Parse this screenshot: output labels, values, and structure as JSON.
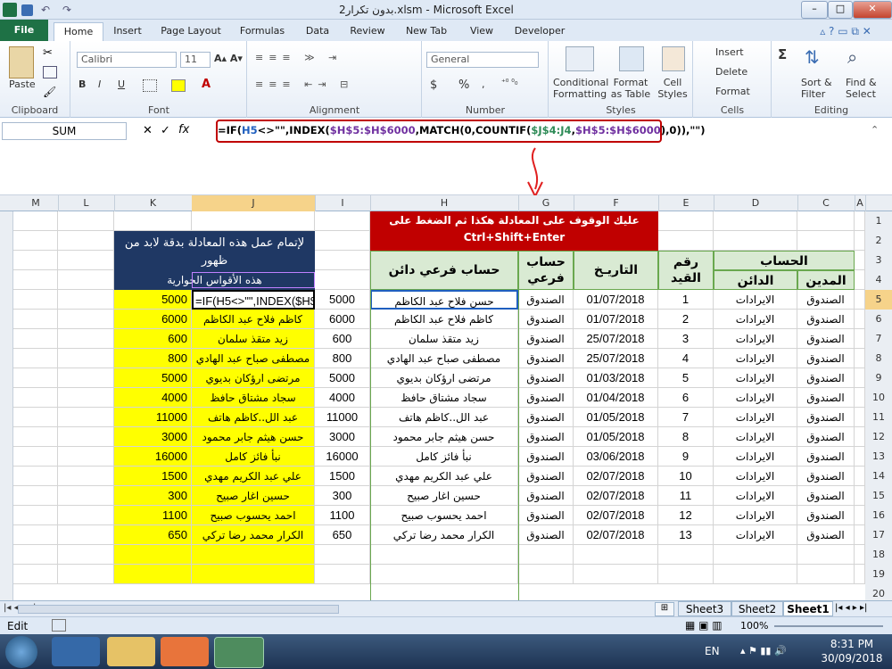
{
  "window": {
    "title": "بدون تكرار2.xlsm - Microsoft Excel"
  },
  "tabs": [
    {
      "label": "File"
    },
    {
      "label": "Home"
    },
    {
      "label": "Insert"
    },
    {
      "label": "Page Layout"
    },
    {
      "label": "Formulas"
    },
    {
      "label": "Data"
    },
    {
      "label": "Review"
    },
    {
      "label": "New Tab"
    },
    {
      "label": "View"
    },
    {
      "label": "Developer"
    }
  ],
  "ribbon": {
    "clipboard": {
      "label": "Clipboard",
      "paste": "Paste"
    },
    "font": {
      "label": "Font",
      "name": "Calibri",
      "size": "11"
    },
    "alignment": {
      "label": "Alignment"
    },
    "number": {
      "label": "Number",
      "format": "General",
      "currency": "$",
      "percent": "%"
    },
    "styles": {
      "label": "Styles",
      "conditional": "Conditional",
      "conditional2": "Formatting",
      "format_table": "Format",
      "format_table2": "as Table",
      "cell_styles": "Cell",
      "cell_styles2": "Styles"
    },
    "cells": {
      "label": "Cells",
      "insert": "Insert",
      "delete": "Delete",
      "format": "Format"
    },
    "editing": {
      "label": "Editing",
      "sum": "Σ",
      "sort": "Sort &",
      "sort2": "Filter",
      "find": "Find &",
      "find2": "Select"
    }
  },
  "formula_bar": {
    "name_box": "SUM",
    "fx": "fx",
    "formula": "=IF(H5<>\"\",INDEX($H$5:$H$6000,MATCH(0,COUNTIF($J$4:J4,$H$5:$H$6000),0)),\"\")"
  },
  "columns": [
    "M",
    "L",
    "K",
    "J",
    "I",
    "H",
    "G",
    "F",
    "E",
    "D",
    "C",
    "A"
  ],
  "rows": [
    "1",
    "2",
    "3",
    "4",
    "5",
    "6",
    "7",
    "8",
    "9",
    "10",
    "11",
    "12",
    "13",
    "14",
    "15",
    "16",
    "17",
    "18",
    "19",
    "20"
  ],
  "sheet": {
    "instruction_1": "عليك الوقوف على المعادلة هكذا ثم الضغط على",
    "instruction_2": "Ctrl+Shift+Enter",
    "note_1": "لإتمام عمل هذه المعادلة بدقة لابد من ظهور",
    "note_2": "هذه الأقواس الحوارية",
    "hdr_account": "الحساب",
    "hdr_debit": "المدين",
    "hdr_credit": "الدائن",
    "hdr_entry": "رقم القيد",
    "hdr_date": "التاريـخ",
    "hdr_sub": "حساب فرعي",
    "hdr_sub_credit": "حساب فرعي دائن",
    "editing_formula": "=IF(H5<>\"\",INDEX($H$",
    "data_rows": [
      {
        "c": "الصندوق",
        "d": "الايرادات",
        "e": "1",
        "f": "01/07/2018",
        "g": "الصندوق",
        "h": "حسن فلاح عبد الكاظم",
        "i": "5000",
        "j": "",
        "k": "5000"
      },
      {
        "c": "الصندوق",
        "d": "الايرادات",
        "e": "2",
        "f": "01/07/2018",
        "g": "الصندوق",
        "h": "كاظم فلاح عبد الكاظم",
        "i": "6000",
        "j": "كاظم فلاح عبد الكاظم",
        "k": "6000"
      },
      {
        "c": "الصندوق",
        "d": "الايرادات",
        "e": "3",
        "f": "25/07/2018",
        "g": "الصندوق",
        "h": "زيد متقذ سلمان",
        "i": "600",
        "j": "زيد متقذ سلمان",
        "k": "600"
      },
      {
        "c": "الصندوق",
        "d": "الايرادات",
        "e": "4",
        "f": "25/07/2018",
        "g": "الصندوق",
        "h": "مصطفى صباح عبد الهادي",
        "i": "800",
        "j": "مصطفى صباح عبد الهادي",
        "k": "800"
      },
      {
        "c": "الصندوق",
        "d": "الايرادات",
        "e": "5",
        "f": "01/03/2018",
        "g": "الصندوق",
        "h": "مرتضى ارؤكان بديوي",
        "i": "5000",
        "j": "مرتضى ارؤكان بديوي",
        "k": "5000"
      },
      {
        "c": "الصندوق",
        "d": "الايرادات",
        "e": "6",
        "f": "01/04/2018",
        "g": "الصندوق",
        "h": "سجاد مشتاق حافظ",
        "i": "4000",
        "j": "سجاد مشتاق حافظ",
        "k": "4000"
      },
      {
        "c": "الصندوق",
        "d": "الايرادات",
        "e": "7",
        "f": "01/05/2018",
        "g": "الصندوق",
        "h": "عبد الل..كاظم هاتف",
        "i": "11000",
        "j": "عبد الل..كاظم هاتف",
        "k": "11000"
      },
      {
        "c": "الصندوق",
        "d": "الايرادات",
        "e": "8",
        "f": "01/05/2018",
        "g": "الصندوق",
        "h": "حسن هيثم جابر محمود",
        "i": "3000",
        "j": "حسن هيثم جابر محمود",
        "k": "3000"
      },
      {
        "c": "الصندوق",
        "d": "الايرادات",
        "e": "9",
        "f": "03/06/2018",
        "g": "الصندوق",
        "h": "نبأ فائز كامل",
        "i": "16000",
        "j": "نبأ فائز كامل",
        "k": "16000"
      },
      {
        "c": "الصندوق",
        "d": "الايرادات",
        "e": "10",
        "f": "02/07/2018",
        "g": "الصندوق",
        "h": "علي عبد الكريم مهدي",
        "i": "1500",
        "j": "علي عبد الكريم مهدي",
        "k": "1500"
      },
      {
        "c": "الصندوق",
        "d": "الايرادات",
        "e": "11",
        "f": "02/07/2018",
        "g": "الصندوق",
        "h": "حسين اغار صبيح",
        "i": "300",
        "j": "حسين اغار صبيح",
        "k": "300"
      },
      {
        "c": "الصندوق",
        "d": "الايرادات",
        "e": "12",
        "f": "02/07/2018",
        "g": "الصندوق",
        "h": "احمد يحسوب صبيح",
        "i": "1100",
        "j": "احمد يحسوب صبيح",
        "k": "1100"
      },
      {
        "c": "الصندوق",
        "d": "الايرادات",
        "e": "13",
        "f": "02/07/2018",
        "g": "الصندوق",
        "h": "الكرار محمد رضا تركي",
        "i": "650",
        "j": "الكرار محمد رضا تركي",
        "k": "650"
      }
    ]
  },
  "sheet_tabs": [
    "Sheet3",
    "Sheet2",
    "Sheet1"
  ],
  "status": {
    "mode": "Edit",
    "zoom": "100%"
  },
  "taskbar": {
    "lang": "EN",
    "time": "8:31 PM",
    "date": "30/09/2018"
  },
  "colors": {
    "excel_green": "#1e7145",
    "header_red": "#c00000",
    "note_navy": "#1f3864",
    "highlight_yellow": "#ffff00",
    "header_green": "#d9ead3"
  }
}
